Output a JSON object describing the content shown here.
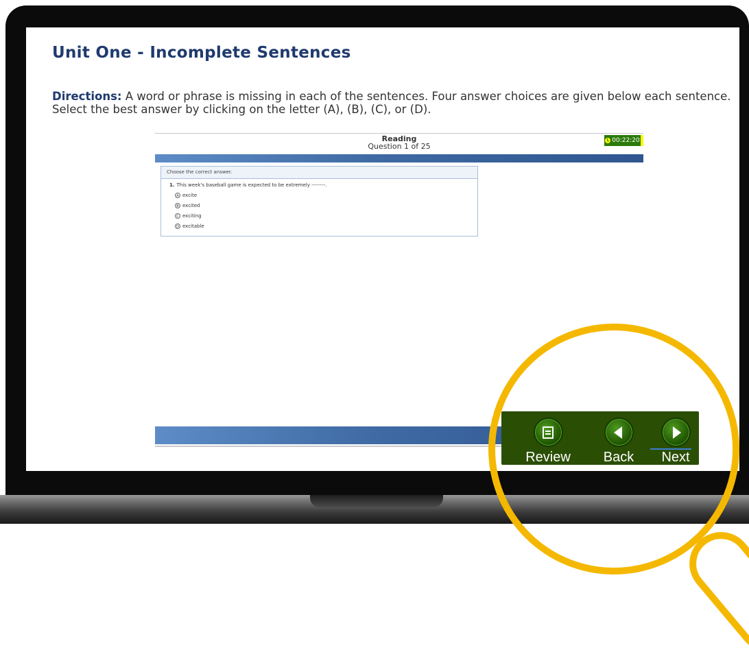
{
  "screen": {
    "title": "Unit One - Incomplete Sentences",
    "directions_label": "Directions:",
    "directions_text": " A word or phrase is missing in each of the sentences. Four answer choices are given below each sentence. Select the best answer by clicking on the letter (A), (B), (C), or (D)."
  },
  "test": {
    "section": "Reading",
    "progress": "Question 1 of 25",
    "timer": "00:22:20",
    "instruction": "Choose the correct answer.",
    "question_number": "1.",
    "question_text": "This week's baseball game is expected to be extremely --------.",
    "options": [
      {
        "letter": "A",
        "text": "excite"
      },
      {
        "letter": "B",
        "text": "excited"
      },
      {
        "letter": "C",
        "text": "exciting"
      },
      {
        "letter": "D",
        "text": "excitable"
      }
    ]
  },
  "toolbar": {
    "review_label": "Review",
    "back_label": "Back",
    "next_label": "Next"
  },
  "colors": {
    "title": "#1f3a6e",
    "accent_ring": "#f5b800",
    "toolbar_bg": "#2b4e05",
    "timer_bg": "#2c7a0a",
    "timer_highlight": "#f8f800",
    "header_bar": "#3f6aa3"
  },
  "icons": {
    "timer": "clock-icon",
    "review": "review-list-icon",
    "back": "arrow-left-icon",
    "next": "arrow-right-icon"
  }
}
